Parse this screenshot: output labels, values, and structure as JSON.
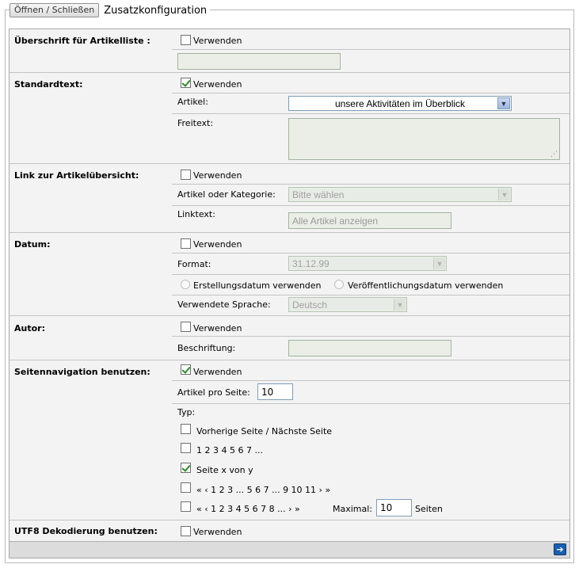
{
  "header": {
    "toggle_label": "Öffnen / Schließen",
    "title": "Zusatzkonfiguration"
  },
  "sections": {
    "ueberschrift": {
      "label": "Überschrift für Artikelliste :",
      "use_label": "Verwenden",
      "checked": false,
      "text_value": ""
    },
    "standardtext": {
      "label": "Standardtext:",
      "use_label": "Verwenden",
      "checked": true,
      "artikel_label": "Artikel:",
      "artikel_value": "unsere Aktivitäten im Überblick",
      "freitext_label": "Freitext:",
      "freitext_value": ""
    },
    "link": {
      "label": "Link zur Artikelübersicht:",
      "use_label": "Verwenden",
      "checked": false,
      "category_label": "Artikel oder Kategorie:",
      "category_value": "Bitte wählen",
      "linktext_label": "Linktext:",
      "linktext_value": "Alle Artikel anzeigen"
    },
    "datum": {
      "label": "Datum:",
      "use_label": "Verwenden",
      "checked": false,
      "format_label": "Format:",
      "format_value": "31.12.99",
      "radio_create": "Erstellungsdatum verwenden",
      "radio_publish": "Veröffentlichungsdatum verwenden",
      "language_label": "Verwendete Sprache:",
      "language_value": "Deutsch"
    },
    "autor": {
      "label": "Autor:",
      "use_label": "Verwenden",
      "checked": false,
      "caption_label": "Beschriftung:",
      "caption_value": ""
    },
    "seitennavigation": {
      "label": "Seitennavigation benutzen:",
      "use_label": "Verwenden",
      "checked": true,
      "per_page_label": "Artikel pro Seite:",
      "per_page_value": "10",
      "typ_label": "Typ:",
      "options": [
        {
          "label": "Vorherige Seite / Nächste Seite",
          "checked": false
        },
        {
          "label": "1 2 3 4 5 6 7 ...",
          "checked": false
        },
        {
          "label": "Seite x von y",
          "checked": true
        },
        {
          "label": "« ‹ 1 2 3 ... 5 6 7 ... 9 10 11 › »",
          "checked": false
        },
        {
          "label": "« ‹ 1 2 3 4 5 6 7 8 ... › »",
          "checked": false
        }
      ],
      "max_label": "Maximal:",
      "max_value": "10",
      "max_unit": "Seiten"
    },
    "utf8": {
      "label": "UTF8 Dekodierung benutzen:",
      "use_label": "Verwenden",
      "checked": false
    }
  },
  "icons": {
    "next": "arrow-right-icon",
    "dropdown": "chevron-down-icon",
    "resize": "resize-grip-icon"
  },
  "colors": {
    "next_button": "#1a5fb0",
    "check": "#2a8a2a"
  }
}
